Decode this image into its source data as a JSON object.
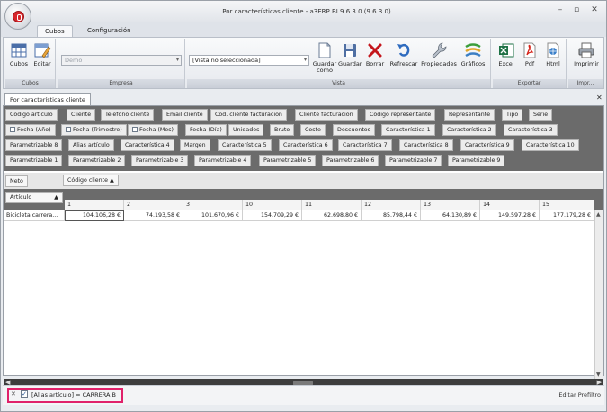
{
  "window": {
    "title": "Por características cliente - a3ERP BI 9.6.3.0 (9.6.3.0)"
  },
  "ribbon_tabs": [
    "Cubos",
    "Configuración"
  ],
  "ribbon": {
    "cubos": {
      "buttons": [
        "Cubos",
        "Editar"
      ],
      "footer": "Cubos"
    },
    "empresa": {
      "value": "Demo",
      "footer": "Empresa"
    },
    "vista": {
      "value": "[Vista no seleccionada]",
      "buttons": [
        "Guardar como",
        "Guardar",
        "Borrar",
        "Refrescar",
        "Propiedades",
        "Gráficos"
      ],
      "footer": "Vista"
    },
    "exportar": {
      "buttons": [
        "Excel",
        "Pdf",
        "Html"
      ],
      "footer": "Exportar"
    },
    "imprimir": {
      "buttons": [
        "Imprimir"
      ],
      "footer": "Impr..."
    }
  },
  "document_tab": "Por características cliente",
  "field_chips": {
    "row1": [
      "Código artículo",
      "Cliente",
      "Teléfono cliente",
      "Email cliente",
      "Cód. cliente facturación",
      "Cliente facturación",
      "Código representante",
      "Representante",
      "Tipo",
      "Serie"
    ],
    "row2": [
      "Fecha (Año)",
      "Fecha (Trimestre)",
      "Fecha (Mes)",
      "Fecha (Día)",
      "Unidades",
      "Bruto",
      "Coste",
      "Descuentos",
      "Característica 1",
      "Característica 2",
      "Característica 3"
    ],
    "row3": [
      "Parametrizable 8",
      "Alias artículo",
      "Característica 4",
      "Margen",
      "Característica 5",
      "Característica 6",
      "Característica 7",
      "Característica 8",
      "Característica 9",
      "Característica 10"
    ],
    "row4": [
      "Parametrizable 1",
      "Parametrizable 2",
      "Parametrizable 3",
      "Parametrizable 4",
      "Parametrizable 5",
      "Parametrizable 6",
      "Parametrizable 7",
      "Parametrizable 9"
    ]
  },
  "data_field": "Neto",
  "column_field": "Código cliente",
  "row_field": "Artículo",
  "grid": {
    "columns": [
      "1",
      "2",
      "3",
      "10",
      "11",
      "12",
      "13",
      "14",
      "15"
    ],
    "rows": [
      {
        "label": "Bicicleta carrera...",
        "values": [
          "104.106,28 €",
          "74.193,58 €",
          "101.670,96 €",
          "154.709,29 €",
          "62.698,80 €",
          "85.798,44 €",
          "64.130,89 €",
          "149.597,28 €",
          "177.179,28 €"
        ]
      }
    ]
  },
  "filter": {
    "text": "[Alias artículo] = CARRERA B",
    "checked": true
  },
  "status": {
    "edit_filter": "Editar Prefiltro"
  },
  "colors": {
    "accent": "#e0216a",
    "brand_red": "#d7262b",
    "field_area": "#6b6b6b"
  }
}
